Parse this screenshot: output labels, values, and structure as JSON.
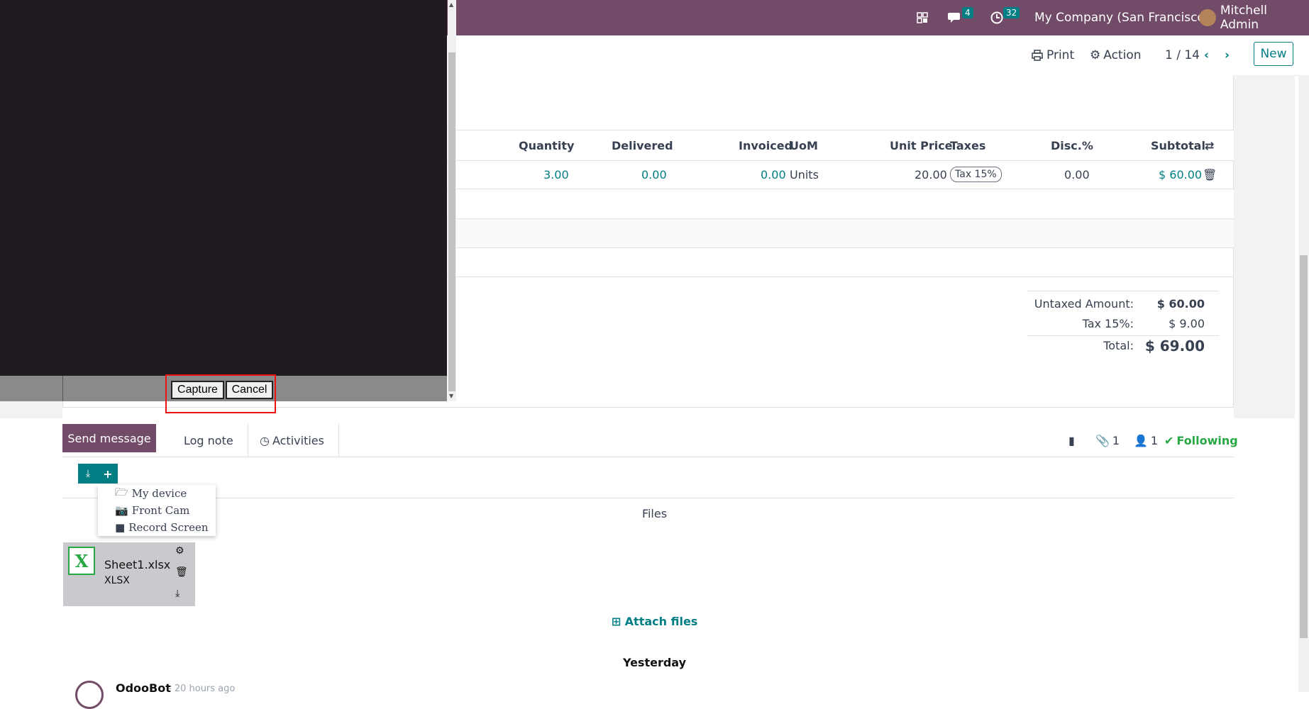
{
  "topbar": {
    "chat_count": "4",
    "activity_count": "32",
    "company": "My Company (San Francisco)",
    "user": "Mitchell Admin"
  },
  "control": {
    "print_label": "Print",
    "action_label": "Action",
    "pager": "1 / 14",
    "new_label": "New"
  },
  "table": {
    "headers": [
      "Quantity",
      "Delivered",
      "Invoiced",
      "UoM",
      "Unit Price",
      "Taxes",
      "Disc.%",
      "Subtotal"
    ],
    "row": {
      "quantity": "3.00",
      "delivered": "0.00",
      "invoiced": "0.00",
      "uom": "Units",
      "unit_price": "20.00",
      "tax": "Tax 15%",
      "discount": "0.00",
      "subtotal": "$ 60.00"
    }
  },
  "totals": {
    "untaxed_label": "Untaxed Amount:",
    "untaxed_value": "$ 60.00",
    "tax_label": "Tax 15%:",
    "tax_value": "$ 9.00",
    "total_label": "Total:",
    "total_value": "$ 69.00"
  },
  "capture": {
    "capture_label": "Capture",
    "cancel_label": "Cancel"
  },
  "chatter": {
    "send_message": "Send message",
    "log_note": "Log note",
    "activities": "Activities",
    "attachments_count": "1",
    "followers_count": "1",
    "following": "Following"
  },
  "upload_menu": {
    "items": [
      "My device",
      "Front Cam",
      "Record Screen"
    ]
  },
  "files": {
    "label": "Files",
    "file_name": "Sheet1.xlsx",
    "file_type": "XLSX",
    "attach_label": "Attach files"
  },
  "messages": {
    "date_separator": "Yesterday",
    "author": "OdooBot",
    "time": "- 20 hours ago"
  }
}
